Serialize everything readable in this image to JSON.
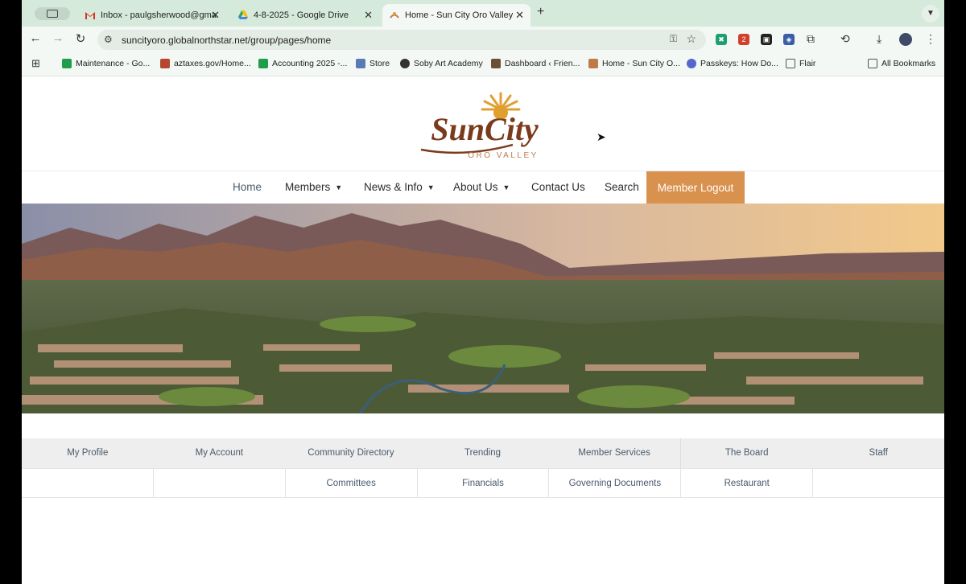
{
  "browser": {
    "tabs": [
      {
        "title": "Inbox - paulgsherwood@gma",
        "icon": "gmail-icon",
        "active": false
      },
      {
        "title": "4-8-2025 - Google Drive",
        "icon": "google-drive-icon",
        "active": false
      },
      {
        "title": "Home - Sun City Oro Valley",
        "icon": "suncity-favicon",
        "active": true
      }
    ],
    "url": "suncityoro.globalnorthstar.net/group/pages/home",
    "extension_badge": "2",
    "bookmarks": [
      {
        "label": "Maintenance - Go...",
        "icon": "sheets-icon",
        "color": "#1e9e4a"
      },
      {
        "label": "aztaxes.gov/Home...",
        "icon": "arizona-flag-icon",
        "color": "#b5462f"
      },
      {
        "label": "Accounting 2025 -...",
        "icon": "sheets-icon",
        "color": "#1e9e4a"
      },
      {
        "label": "Store",
        "icon": "store-icon",
        "color": "#5a7ab5"
      },
      {
        "label": "Soby Art Academy",
        "icon": "art-icon",
        "color": "#333333"
      },
      {
        "label": "Dashboard ‹ Frien...",
        "icon": "dashboard-icon",
        "color": "#6b4f3a"
      },
      {
        "label": "Home - Sun City O...",
        "icon": "suncity-favicon",
        "color": "#c07a4a"
      },
      {
        "label": "Passkeys: How Do...",
        "icon": "passkey-icon",
        "color": "#5566cc"
      },
      {
        "label": "Flair",
        "icon": "folder-icon",
        "color": "#555555"
      }
    ],
    "all_bookmarks": "All Bookmarks"
  },
  "site": {
    "logo": {
      "line1": "SunCity",
      "line2": "ORO VALLEY"
    },
    "nav": {
      "home": "Home",
      "members": "Members",
      "news": "News & Info",
      "about": "About Us",
      "contact": "Contact Us",
      "search": "Search",
      "logout": "Member Logout"
    },
    "hero_alt": "",
    "quick_links_row1": [
      "My Profile",
      "My Account",
      "Community Directory",
      "Trending",
      "Member Services",
      "The Board",
      "Staff"
    ],
    "quick_links_row2": [
      "",
      "",
      "Committees",
      "Financials",
      "Governing Documents",
      "Restaurant",
      ""
    ],
    "colors": {
      "accent": "#d9914e",
      "nav_text": "#4a5a6c",
      "brand_brown": "#7a3b1c",
      "brand_gold": "#e0a030"
    }
  }
}
